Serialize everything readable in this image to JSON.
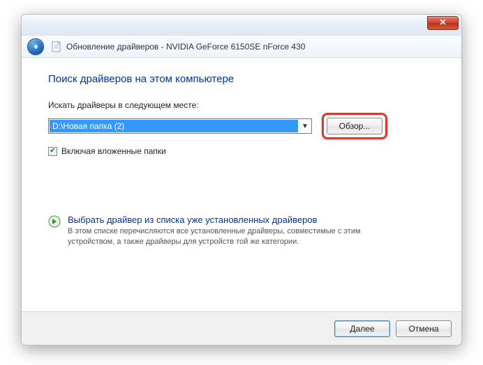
{
  "window": {
    "title": "Обновление драйверов - NVIDIA GeForce 6150SE nForce 430"
  },
  "content": {
    "heading": "Поиск драйверов на этом компьютере",
    "search_label": "Искать драйверы в следующем месте:",
    "path_value": "D:\\Новая папка (2)",
    "browse_label": "Обзор...",
    "include_subfolders_label": "Включая вложенные папки",
    "include_subfolders_checked": true,
    "option": {
      "title": "Выбрать драйвер из списка уже установленных драйверов",
      "desc": "В этом списке перечисляются все установленные драйверы, совместимые с этим устройством, а также драйверы для устройств той же категории."
    }
  },
  "footer": {
    "next_label": "Далее",
    "cancel_label": "Отмена"
  }
}
